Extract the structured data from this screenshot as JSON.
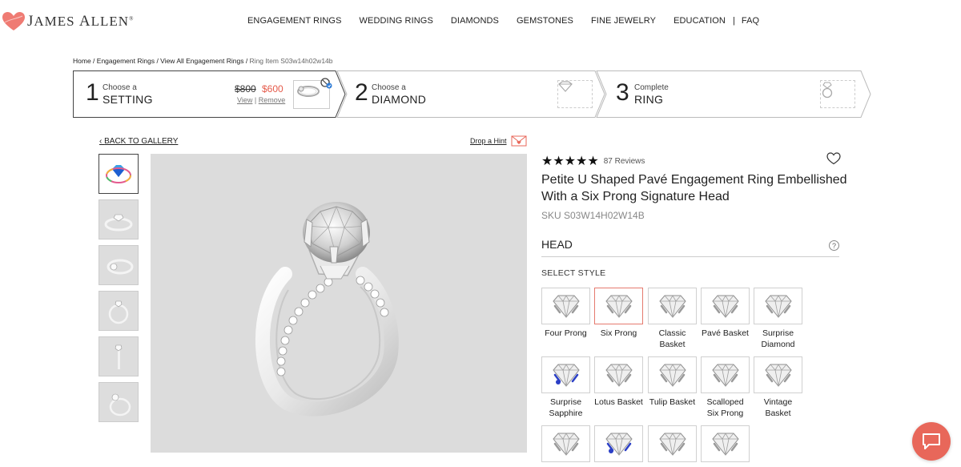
{
  "brand": {
    "name_first": "J",
    "name_rest1": "AMES ",
    "name_second": "A",
    "name_rest2": "LLEN",
    "reg": "®",
    "heart_color": "#ef7b73"
  },
  "nav": {
    "items": [
      "ENGAGEMENT RINGS",
      "WEDDING RINGS",
      "DIAMONDS",
      "GEMSTONES",
      "FINE JEWELRY",
      "EDUCATION",
      "FAQ"
    ],
    "separator": "|"
  },
  "breadcrumb": {
    "items": [
      "Home",
      "Engagement Rings",
      "View All Engagement Rings"
    ],
    "separator": " / ",
    "current": "Ring Item S03w14h02w14b"
  },
  "steps": [
    {
      "number": "1",
      "small": "Choose a",
      "big": "SETTING",
      "price_old": "$800",
      "price_new": "$600",
      "view": "View",
      "remove": "Remove",
      "sep": "|",
      "icon": "ring-setting-icon"
    },
    {
      "number": "2",
      "small": "Choose a",
      "big": "DIAMOND",
      "icon": "diamond-icon"
    },
    {
      "number": "3",
      "small": "Complete",
      "big": "RING",
      "icon": "ring-icon"
    }
  ],
  "gallery": {
    "back_label": "BACK TO GALLERY",
    "thumbnails": [
      "360-view-icon",
      "ring-angle-1",
      "ring-angle-2",
      "ring-front",
      "ring-side",
      "ring-hand"
    ]
  },
  "drop_hint": {
    "label": "Drop a Hint",
    "icon": "envelope-heart-icon"
  },
  "product": {
    "stars": "★★★★★",
    "rating": 5,
    "reviews": "87 Reviews",
    "title": "Petite U Shaped Pavé Engagement Ring Embellished With a Six Prong Signature Head",
    "sku": "SKU S03W14H02W14B"
  },
  "head": {
    "label": "HEAD",
    "help": "?",
    "select_style": "SELECT STYLE",
    "options": [
      {
        "name": "Four Prong",
        "selected": false
      },
      {
        "name": "Six Prong",
        "selected": true
      },
      {
        "name": "Classic Basket",
        "selected": false
      },
      {
        "name": "Pavé Basket",
        "selected": false
      },
      {
        "name": "Surprise Diamond",
        "selected": false
      },
      {
        "name": "Surprise Sapphire",
        "selected": false,
        "accent": "#2b3fc6"
      },
      {
        "name": "Lotus Basket",
        "selected": false
      },
      {
        "name": "Tulip Basket",
        "selected": false
      },
      {
        "name": "Scalloped Six Prong",
        "selected": false
      },
      {
        "name": "Vintage Basket",
        "selected": false
      },
      {
        "name": "",
        "selected": false
      },
      {
        "name": "",
        "selected": false,
        "accent": "#2b3fc6"
      },
      {
        "name": "",
        "selected": false
      },
      {
        "name": "",
        "selected": false
      }
    ]
  },
  "colors": {
    "accent": "#e55a4a",
    "chat": "#e8675a",
    "image_bg": "#dcdcdc"
  },
  "chat": {
    "icon": "chat-bubble-icon"
  }
}
